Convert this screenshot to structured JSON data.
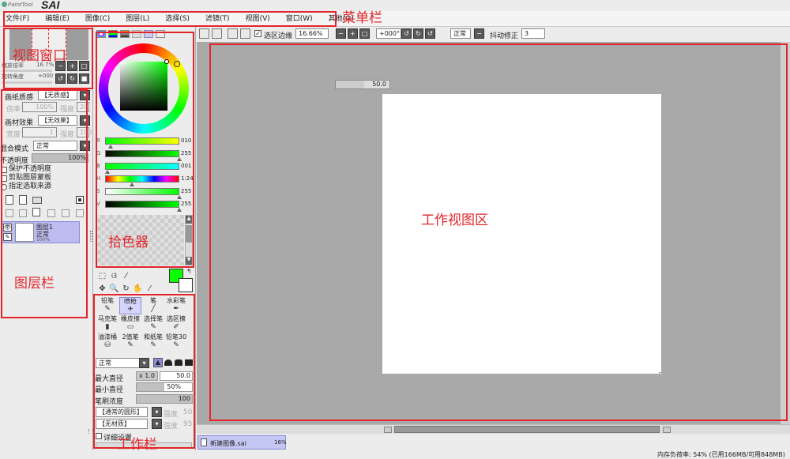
{
  "app": {
    "logo_small": "PaintTool",
    "logo_big": "SAI"
  },
  "menu": [
    "文件(F)",
    "编辑(E)",
    "图像(C)",
    "图层(L)",
    "选择(S)",
    "滤镜(T)",
    "视图(V)",
    "窗口(W)",
    "其他(O)"
  ],
  "annotations": {
    "menu_bar": "菜单栏",
    "view_window": "视图窗口",
    "color_picker": "拾色器",
    "layer_bar": "图层栏",
    "tool_bar": "工作栏",
    "work_area": "工作视图区"
  },
  "toolbar": {
    "selection_edge_label": "选区边缘",
    "zoom": "16.66%",
    "angle": "+000°",
    "blend": "正常",
    "stabilizer_label": "抖动修正",
    "stabilizer_value": "3"
  },
  "navigator": {
    "zoom_label": "缩放倍率",
    "zoom_value": "16.7%",
    "rotate_label": "旋转角度",
    "rotate_value": "+000"
  },
  "layer_panel": {
    "paper_texture_label": "画纸质感",
    "paper_texture_value": "【无质感】",
    "scale_label": "倍率",
    "scale_value": "100%",
    "strength_label": "强度",
    "strength_value": "20",
    "paper_effect_label": "画材效果",
    "paper_effect_value": "【无效果】",
    "width_label": "宽度",
    "width_value": "1",
    "strength2_label": "强度",
    "strength2_value": "100",
    "blend_label": "混合模式",
    "blend_value": "正常",
    "opacity_label": "不透明度",
    "opacity_value": "100%",
    "checks": [
      "保护不透明度",
      "剪贴图层蒙板",
      "指定选取来源"
    ],
    "layers": [
      {
        "name": "图层1",
        "mode": "正常",
        "opacity": "100%"
      }
    ]
  },
  "color": {
    "channels": [
      {
        "label": "R",
        "value": "010",
        "level": 0.04
      },
      {
        "label": "G",
        "value": "255",
        "level": 1.0
      },
      {
        "label": "B",
        "value": "001",
        "level": 0.0
      },
      {
        "label": "H",
        "value": "1:24",
        "level": 0.34
      },
      {
        "label": "S",
        "value": "255",
        "level": 1.0
      },
      {
        "label": "V",
        "value": "255",
        "level": 1.0
      }
    ],
    "primary": "#0aff01",
    "secondary": "#ffffff"
  },
  "tools": {
    "brushes": [
      {
        "label": "铅笔",
        "icon": "pencil-icon"
      },
      {
        "label": "喷枪",
        "icon": "airbrush-icon"
      },
      {
        "label": "笔",
        "icon": "pen-icon"
      },
      {
        "label": "水彩笔",
        "icon": "watercolor-icon"
      },
      {
        "label": "马克笔",
        "icon": "marker-icon"
      },
      {
        "label": "橡皮擦",
        "icon": "eraser-icon"
      },
      {
        "label": "选择笔",
        "icon": "select-pen-icon"
      },
      {
        "label": "选区擦",
        "icon": "select-eraser-icon"
      },
      {
        "label": "油漆桶",
        "icon": "bucket-icon"
      },
      {
        "label": "2值笔",
        "icon": "binary-pen-icon"
      },
      {
        "label": "和纸笔",
        "icon": "washi-pen-icon"
      },
      {
        "label": "铅笔30",
        "icon": "pencil30-icon"
      }
    ],
    "blend": "正常",
    "max_size_label": "最大直径",
    "max_size_mult": "x 1.0",
    "max_size_value": "50.0",
    "min_size_label": "最小直径",
    "min_size_value": "50%",
    "density_label": "笔刷浓度",
    "density_value": "100",
    "shape": "【通常的圆形】",
    "shape_strength": "50",
    "texture": "【无材质】",
    "texture_strength": "95",
    "detail": "详细设置"
  },
  "canvas": {
    "brush_size": "50.0",
    "tab_name": "新建图像.sai",
    "tab_zoom": "16%"
  },
  "status": {
    "memory": "内存负荷率: 54% (已用166MB/可用848MB)"
  },
  "colors": {
    "accent_red": "#e0262b",
    "canvas_bg": "#a8a8a8"
  }
}
